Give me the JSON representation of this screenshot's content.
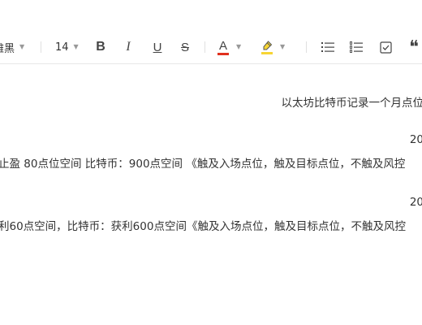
{
  "toolbar": {
    "font_family": "雅黑",
    "font_size": "14",
    "bold_label": "B",
    "italic_label": "I",
    "underline_label": "U",
    "strike_label": "S",
    "font_color_label": "A",
    "font_color": "#e0301e",
    "highlight_color": "#f7d534",
    "quote_label": "❝",
    "dropdown_caret": "▼"
  },
  "document": {
    "lines": [
      "以太坊比特币记录一个月点位",
      "20",
      "止盈 80点位空间   比特币：900点空间 《触及入场点位，触及目标点位，不触及风控",
      "20",
      "利60点空间，比特币：获利600点空间《触及入场点位，触及目标点位，不触及风控"
    ]
  }
}
